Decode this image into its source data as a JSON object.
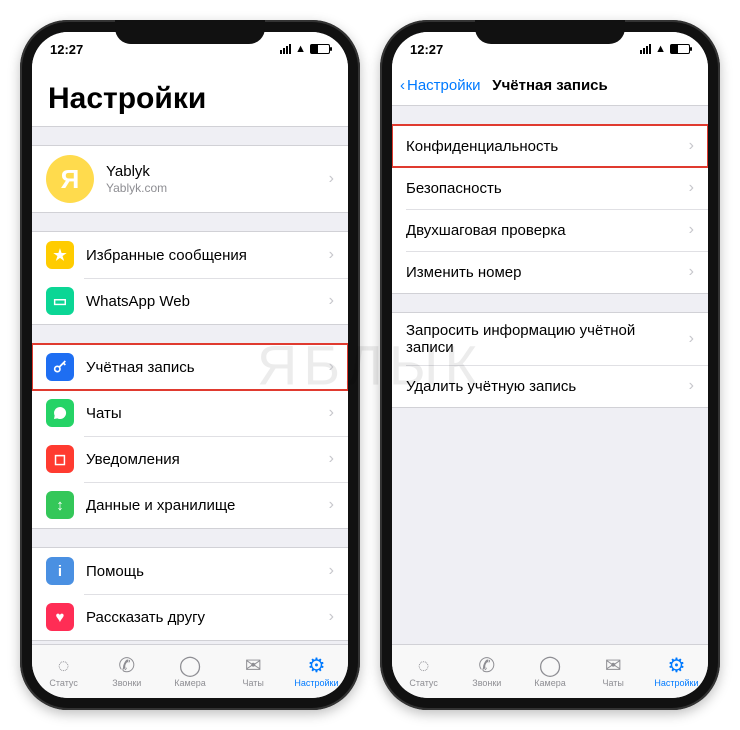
{
  "status": {
    "time": "12:27"
  },
  "watermark": "ЯБЛЫК",
  "tabs": {
    "status": "Статус",
    "calls": "Звонки",
    "camera": "Камера",
    "chats": "Чаты",
    "settings": "Настройки"
  },
  "left": {
    "title": "Настройки",
    "profile": {
      "name": "Yablyk",
      "sub": "Yablyk.com",
      "initial": "Я"
    },
    "g1": {
      "starred": "Избранные сообщения",
      "web": "WhatsApp Web"
    },
    "g2": {
      "account": "Учётная запись",
      "chats": "Чаты",
      "notifications": "Уведомления",
      "data": "Данные и хранилище"
    },
    "g3": {
      "help": "Помощь",
      "tell": "Рассказать другу"
    }
  },
  "right": {
    "back": "Настройки",
    "title": "Учётная запись",
    "g1": {
      "privacy": "Конфиденциальность",
      "security": "Безопасность",
      "twostep": "Двухшаговая проверка",
      "change": "Изменить номер"
    },
    "g2": {
      "request": "Запросить информацию учётной записи",
      "delete": "Удалить учётную запись"
    }
  }
}
